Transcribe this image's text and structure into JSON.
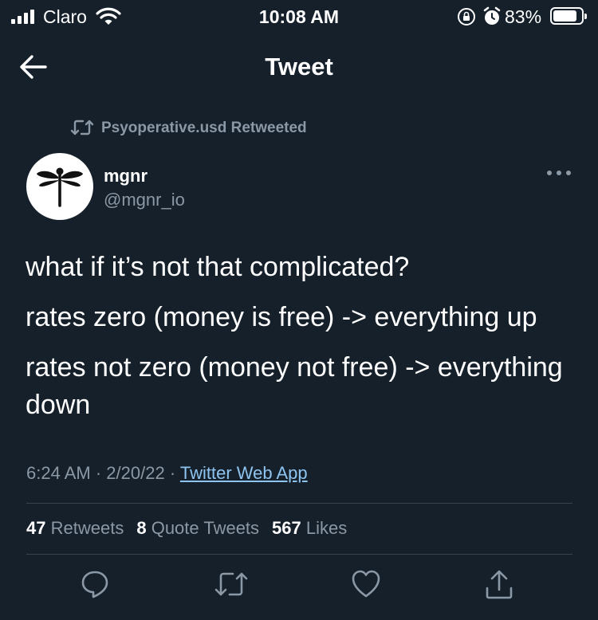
{
  "status_bar": {
    "carrier": "Claro",
    "time": "10:08 AM",
    "battery_percent": "83%",
    "battery_level": 0.83
  },
  "header": {
    "title": "Tweet"
  },
  "retweet_context": {
    "text": "Psyoperative.usd Retweeted"
  },
  "author": {
    "name": "mgnr",
    "handle": "@mgnr_io"
  },
  "tweet": {
    "paragraphs": [
      "what if it’s not that complicated?",
      "rates zero (money is free) -> everything up",
      "rates not zero (money not free) -> everything down"
    ],
    "time": "6:24 AM",
    "date": "2/20/22",
    "separator": "·",
    "source": "Twitter Web App"
  },
  "stats": {
    "retweets_count": "47",
    "retweets_label": "Retweets",
    "quotes_count": "8",
    "quotes_label": "Quote Tweets",
    "likes_count": "567",
    "likes_label": "Likes"
  },
  "colors": {
    "background": "#15202b",
    "text_primary": "#ffffff",
    "text_secondary": "#8b98a5",
    "link": "#8ec4f0",
    "divider": "#38444d"
  },
  "icons": {
    "back": "arrow-left-icon",
    "retweet": "retweet-icon",
    "more": "more-horizontal-icon",
    "reply": "reply-icon",
    "like": "heart-icon",
    "share": "share-icon"
  }
}
